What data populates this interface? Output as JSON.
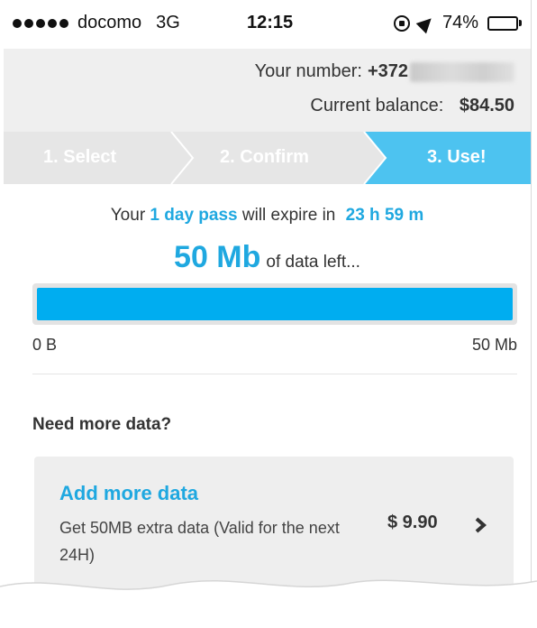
{
  "status_bar": {
    "carrier": "docomo",
    "network": "3G",
    "time": "12:15",
    "battery": "74%",
    "battery_level": 0.74,
    "icons": [
      "signal-dots",
      "rotation-lock-icon",
      "location-arrow-icon",
      "battery-icon"
    ]
  },
  "account": {
    "number_label": "Your number:",
    "number_prefix": "+372",
    "balance_label": "Current balance:",
    "balance_value": "$84.50"
  },
  "steps": [
    {
      "label": "1. Select",
      "active": false
    },
    {
      "label": "2. Confirm",
      "active": false
    },
    {
      "label": "3. Use!",
      "active": true
    }
  ],
  "pass": {
    "prefix": "Your",
    "name": "1 day pass",
    "middle": "will expire in",
    "time_left": "23 h 59 m",
    "data_left": "50 Mb",
    "data_suffix": "of data left...",
    "usage_fraction": 1.0,
    "bar_min": "0 B",
    "bar_max": "50 Mb"
  },
  "more": {
    "heading": "Need more data?",
    "card_title": "Add more data",
    "card_desc": "Get 50MB extra data (Valid for the next 24H)",
    "card_price": "$ 9.90"
  },
  "colors": {
    "accent": "#1fa8e0",
    "bar": "#00adf0",
    "step_active": "#4dc3f0",
    "step_inactive": "#e6e6e6"
  }
}
